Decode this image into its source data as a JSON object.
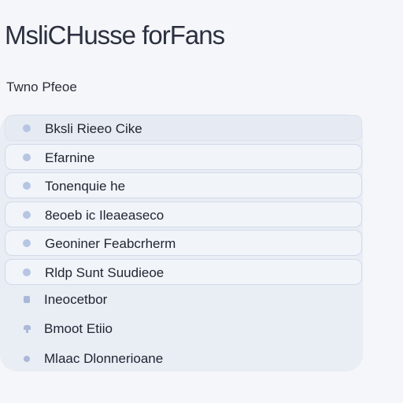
{
  "header": {
    "title": "MsliCHusse forFans"
  },
  "section": {
    "title": "Twno Pfeoe"
  },
  "list": {
    "items": [
      {
        "label": "Bksli Rieeo Cike"
      },
      {
        "label": "Efarnine"
      },
      {
        "label": "Tonenquie he"
      },
      {
        "label": "8eoeb ic Ileaeaseco"
      },
      {
        "label": "Geoniner Feabcrherm"
      },
      {
        "label": "Rldp Sunt Suudieoe"
      }
    ],
    "footer_items": [
      {
        "label": "Ineocetbor"
      },
      {
        "label": "Bmoot  Etiio"
      },
      {
        "label": "Mlaac Dlonnerioane"
      }
    ]
  },
  "colors": {
    "panel": "#e9edf4",
    "row_border": "#d2dbea",
    "bullet": "#b6c5e3"
  }
}
